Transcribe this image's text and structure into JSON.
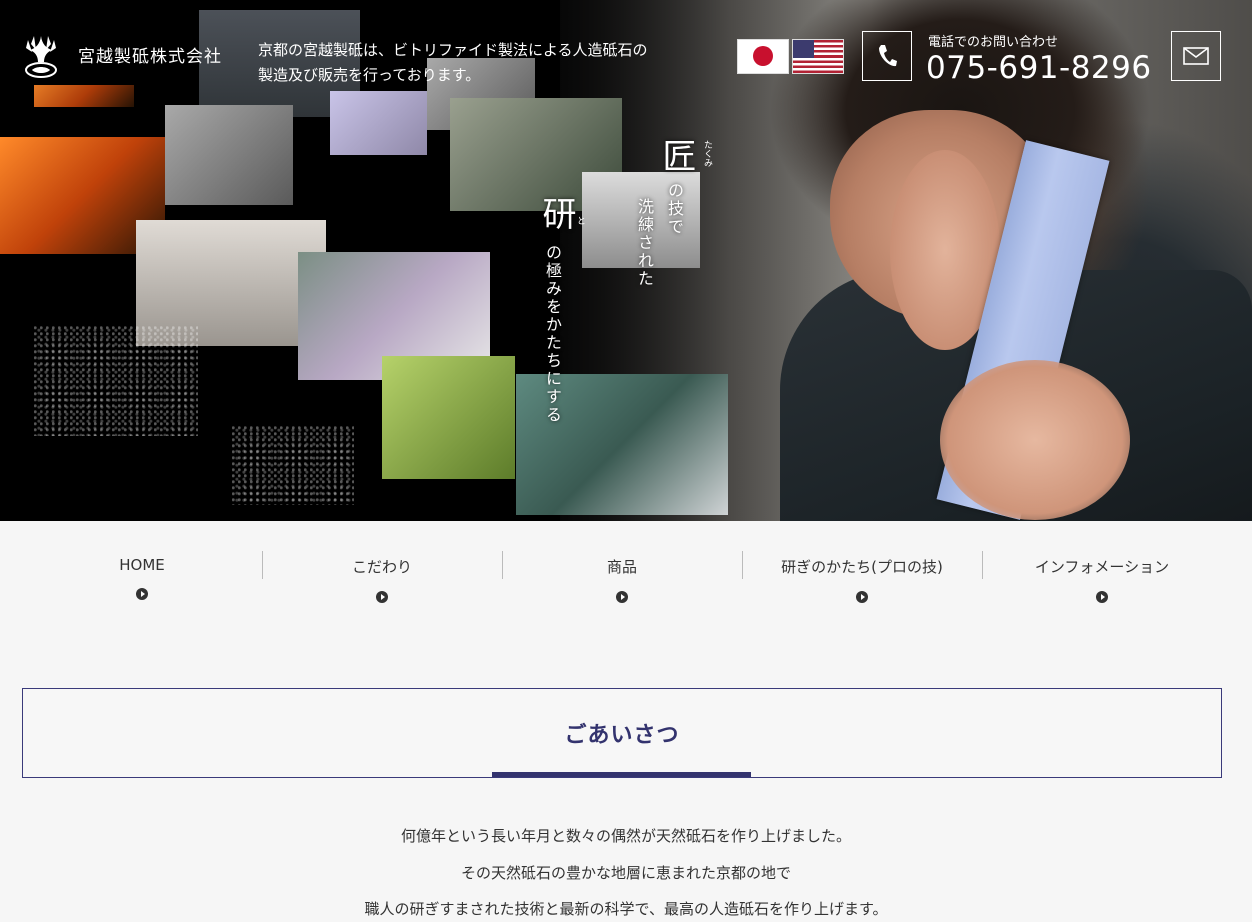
{
  "header": {
    "company_name": "宮越製砥株式会社",
    "tagline": "京都の宮越製砥は、ビトリファイド製法による人造砥石の製造及び販売を行っております。",
    "phone_label": "電話でのお問い合わせ",
    "phone_number": "075-691-8296"
  },
  "hero": {
    "vertical_title_1": "匠",
    "vertical_rest_1": "の技で",
    "vertical_line_2": "洗練された",
    "vertical_title_3": "研",
    "vertical_rest_3": "の極みをかたちにする",
    "ruby_1": "たくみ",
    "ruby_3": "と"
  },
  "nav": {
    "items": [
      {
        "label": "HOME"
      },
      {
        "label": "こだわり"
      },
      {
        "label": "商品"
      },
      {
        "label": "研ぎのかたち(プロの技)"
      },
      {
        "label": "インフォメーション"
      }
    ]
  },
  "greeting": {
    "title": "ごあいさつ",
    "paragraphs": [
      "何億年という長い年月と数々の偶然が天然砥石を作り上げました。",
      "その天然砥石の豊かな地層に恵まれた京都の地で",
      "職人の研ぎすまされた技術と最新の科学で、最高の人造砥石を作り上げます。"
    ]
  },
  "icons": {
    "logo": "crane-crest-logo",
    "phone": "phone-icon",
    "mail": "mail-icon",
    "flags": [
      "japan-flag-icon",
      "usa-flag-icon"
    ],
    "nav_arrow": "play-circle-icon"
  },
  "colors": {
    "accent": "#33336e",
    "text": "#333333"
  }
}
